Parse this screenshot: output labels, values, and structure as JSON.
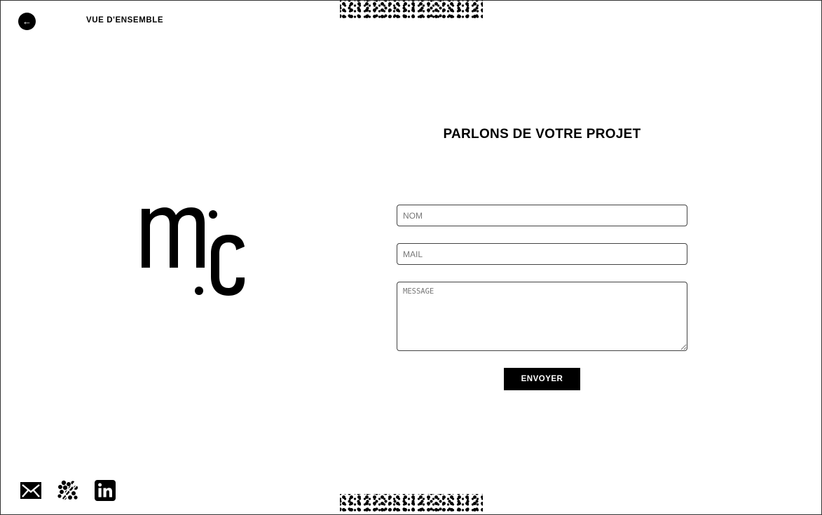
{
  "nav": {
    "back_icon": "arrow-left-icon",
    "back_glyph": "←",
    "overview_label": "VUE D'ENSEMBLE"
  },
  "logo": {
    "text": "m:c"
  },
  "contact": {
    "title": "PARLONS DE VOTRE PROJET",
    "name_placeholder": "NOM",
    "mail_placeholder": "MAIL",
    "message_placeholder": "MESSAGE",
    "submit_label": "ENVOYER"
  },
  "social": {
    "icons": [
      "mail-icon",
      "dotted-brand-icon",
      "linkedin-icon"
    ]
  },
  "colors": {
    "background": "#ffffff",
    "foreground": "#000000",
    "border": "#444444"
  }
}
